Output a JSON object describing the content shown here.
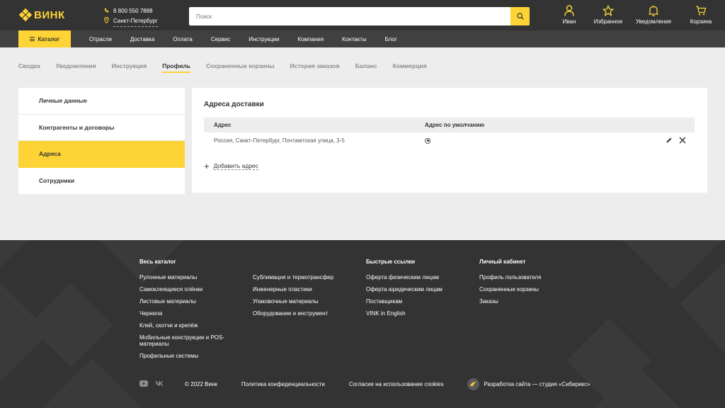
{
  "brand": {
    "name": "ВИНК",
    "accent": "#fdd335"
  },
  "header": {
    "phone": "8 800 550 7888",
    "city": "Санкт-Петербург",
    "search_placeholder": "Поиск",
    "icons": [
      {
        "label": "Иван",
        "icon": "user-icon"
      },
      {
        "label": "Избранное",
        "icon": "star-icon"
      },
      {
        "label": "Уведомления",
        "icon": "bell-icon"
      },
      {
        "label": "Корзина",
        "icon": "cart-icon"
      }
    ]
  },
  "nav": {
    "catalog_label": "Каталог",
    "links": [
      "Отрасли",
      "Доставка",
      "Оплата",
      "Сервис",
      "Инструкции",
      "Компания",
      "Контакты",
      "Блог"
    ]
  },
  "tabs": {
    "items": [
      "Сводка",
      "Уведомления",
      "Инструкция",
      "Профиль",
      "Сохраненные корзины",
      "История заказов",
      "Баланс",
      "Коммерция"
    ],
    "active": "Профиль"
  },
  "sidebar": {
    "items": [
      "Личные данные",
      "Контрагенты и договоры",
      "Адреса",
      "Сотрудники"
    ],
    "active": "Адреса"
  },
  "main": {
    "title": "Адреса доставки",
    "columns": {
      "address": "Адрес",
      "default": "Адрес по умолчанию"
    },
    "rows": [
      {
        "address": "Россия, Санкт-Петербург, Почтамтская улица, 3-5",
        "is_default": true
      }
    ],
    "add_label": "Добавить адрес"
  },
  "footer": {
    "col1": {
      "title": "Весь каталог",
      "links": [
        "Рулонные материалы",
        "Самоклеящиеся плёнки",
        "Листовые материалы",
        "Чернила",
        "Клей, скотчи и крепёж",
        "Мобильные конструкции и POS-материалы",
        "Профильные системы"
      ]
    },
    "col2": {
      "links": [
        "Сублимация и термотрансфер",
        "Инженерные пластики",
        "Упаковочные материалы",
        "Оборудование и инструмент"
      ]
    },
    "col3": {
      "title": "Быстрые ссылки",
      "links": [
        "Оферта физическим лицам",
        "Оферта юридическим лицам",
        "Поставщикам",
        "VINK in English"
      ]
    },
    "col4": {
      "title": "Личный кабинет",
      "links": [
        "Профиль пользователя",
        "Сохраненные корзины",
        "Заказы"
      ]
    },
    "copyright": "© 2022 Винк",
    "privacy": "Политика конфиденциальности",
    "cookies": "Согласие на использование cookies",
    "developer": "Разработка сайта — студия «Сибирикс»",
    "social": [
      "youtube-icon",
      "vk-icon"
    ]
  }
}
